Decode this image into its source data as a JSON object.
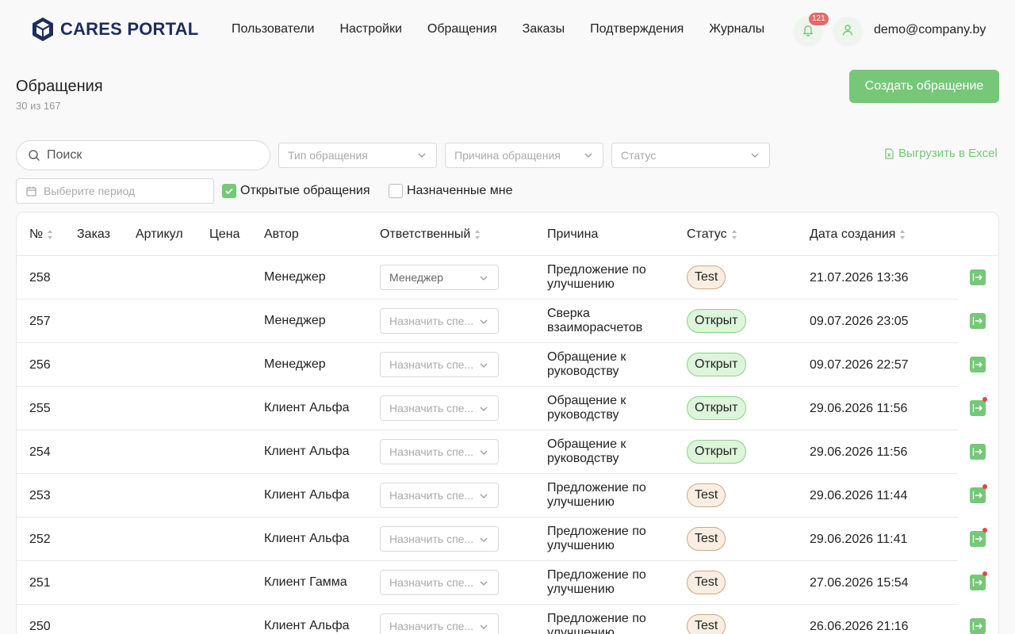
{
  "header": {
    "logo_text": "CARES PORTAL",
    "nav": [
      "Пользователи",
      "Настройки",
      "Обращения",
      "Заказы",
      "Подтверждения",
      "Журналы"
    ],
    "notifications_count": "121",
    "user_email": "demo@company.by",
    "icons": {
      "notifications": "bell-icon",
      "user": "user-icon"
    }
  },
  "page": {
    "title": "Обращения",
    "count": "30 из 167",
    "create_button": "Создать обращение"
  },
  "filters": {
    "search_placeholder": "Поиск",
    "type_placeholder": "Тип обращения",
    "reason_placeholder": "Причина обращения",
    "status_placeholder": "Статус",
    "export_label": "Выгрузить в Excel",
    "period_placeholder": "Выберите период",
    "open_only_label": "Открытые обращения",
    "open_only_checked": true,
    "assigned_to_me_label": "Назначенные мне",
    "assigned_to_me_checked": false
  },
  "table": {
    "columns": [
      "№",
      "Заказ",
      "Артикул",
      "Цена",
      "Автор",
      "Ответственный",
      "Причина",
      "Статус",
      "Дата создания"
    ],
    "responsible_placeholder": "Назначить спе...",
    "rows": [
      {
        "num": "258",
        "author": "Менеджер",
        "responsible": "Менеджер",
        "reason_l1": "Предложение по",
        "reason_l2": "улучшению",
        "status": "Test",
        "date": "21.07.2026 13:36",
        "unread": false
      },
      {
        "num": "257",
        "author": "Менеджер",
        "responsible": "",
        "reason_l1": "Сверка",
        "reason_l2": "взаиморасчетов",
        "status": "Открыт",
        "date": "09.07.2026 23:05",
        "unread": false
      },
      {
        "num": "256",
        "author": "Менеджер",
        "responsible": "",
        "reason_l1": "Обращение к",
        "reason_l2": "руководству",
        "status": "Открыт",
        "date": "09.07.2026 22:57",
        "unread": false
      },
      {
        "num": "255",
        "author": "Клиент Альфа",
        "responsible": "",
        "reason_l1": "Обращение к",
        "reason_l2": "руководству",
        "status": "Открыт",
        "date": "29.06.2026 11:56",
        "unread": true
      },
      {
        "num": "254",
        "author": "Клиент Альфа",
        "responsible": "",
        "reason_l1": "Обращение к",
        "reason_l2": "руководству",
        "status": "Открыт",
        "date": "29.06.2026 11:56",
        "unread": false
      },
      {
        "num": "253",
        "author": "Клиент Альфа",
        "responsible": "",
        "reason_l1": "Предложение по",
        "reason_l2": "улучшению",
        "status": "Test",
        "date": "29.06.2026 11:44",
        "unread": true
      },
      {
        "num": "252",
        "author": "Клиент Альфа",
        "responsible": "",
        "reason_l1": "Предложение по",
        "reason_l2": "улучшению",
        "status": "Test",
        "date": "29.06.2026 11:41",
        "unread": true
      },
      {
        "num": "251",
        "author": "Клиент Гамма",
        "responsible": "",
        "reason_l1": "Предложение по",
        "reason_l2": "улучшению",
        "status": "Test",
        "date": "27.06.2026 15:54",
        "unread": true
      },
      {
        "num": "250",
        "author": "Клиент Альфа",
        "responsible": "",
        "reason_l1": "Предложение по",
        "reason_l2": "улучшению",
        "status": "Test",
        "date": "26.06.2026 21:16",
        "unread": false
      }
    ]
  },
  "colors": {
    "accent": "#76c778",
    "brand": "#1e2d5c",
    "badge": "#e46a6a"
  }
}
